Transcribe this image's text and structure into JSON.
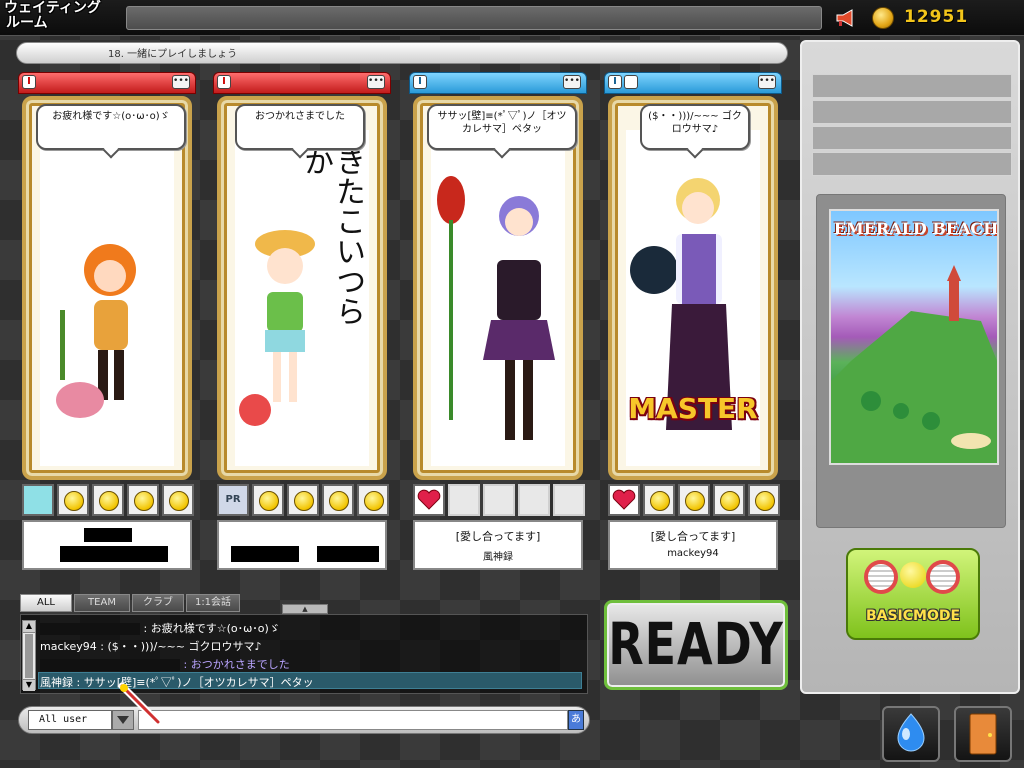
{
  "screen_title_line1": "ウェイティング",
  "screen_title_line2": "ルーム",
  "coins": "12951",
  "room_name": "18. 一緒にプレイしましょう",
  "slots": [
    {
      "team": "red",
      "bubble": "お疲れ様です☆(o･ω･o)ゞ",
      "title": "",
      "name": "",
      "items": [
        "cyan",
        "smile",
        "smile",
        "smile",
        "smile"
      ],
      "master": false
    },
    {
      "team": "red",
      "bubble": "おつかれさまでした",
      "handwriting": "きたこいつらか",
      "title": "",
      "name": "",
      "items": [
        "pr",
        "smile",
        "smile",
        "smile",
        "smile"
      ],
      "master": false
    },
    {
      "team": "blue",
      "bubble": "ササッ[壁]≡(*ﾟ▽ﾟ)ノ［オツカレサマ］ペタッ",
      "title": "[愛し合ってます]",
      "name": "風神録",
      "items": [
        "heart",
        "empty",
        "empty",
        "empty",
        "empty"
      ],
      "master": false
    },
    {
      "team": "blue",
      "bubble": "($・・)))/~~~ ゴクロウサマ♪",
      "title": "[愛し合ってます]",
      "name": "mackey94",
      "items": [
        "heart",
        "smile",
        "smile",
        "smile",
        "smile"
      ],
      "master": true,
      "master_label": "MASTER"
    }
  ],
  "map": {
    "name": "EMERALD BEACH"
  },
  "basic_mode_label": "BASICMODE",
  "chat_tabs": [
    "ALL",
    "TEAM",
    "クラブ",
    "1:1会話"
  ],
  "chat_lines": [
    {
      "speaker": "",
      "text": ": お疲れ様です☆(o･ω･o)ゞ",
      "color": "#ffffff"
    },
    {
      "speaker": "mackey94",
      "text": " : ($・・)))/~~~ ゴクロウサマ♪",
      "color": "#ffffff"
    },
    {
      "speaker": "",
      "text": ": おつかれさまでした",
      "color": "#b9a4ff"
    },
    {
      "speaker": "風神録",
      "text": " : ササッ[壁]≡(*ﾟ▽ﾟ)ノ［オツカレサマ］ペタッ",
      "color": "#ffffff"
    }
  ],
  "chat_scope": "All user",
  "ime_label": "あ",
  "ready_label": "READY",
  "colors": {
    "red_team": "#d82a2a",
    "blue_team": "#2a9ad8",
    "coin_text": "#f3c51a",
    "ready_border": "#6fbf3c"
  }
}
